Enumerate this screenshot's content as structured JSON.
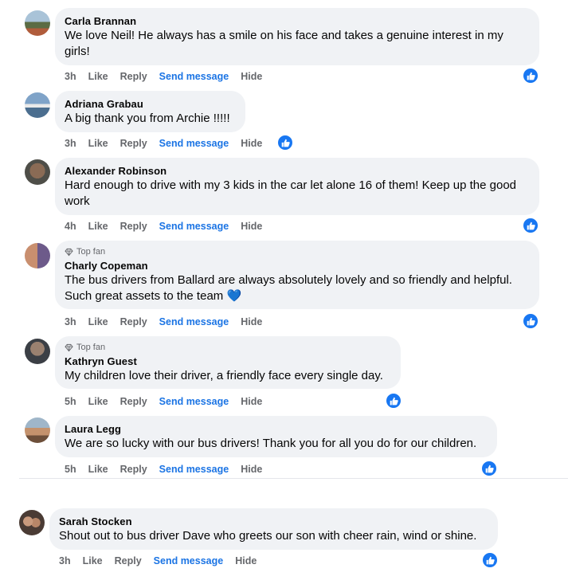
{
  "actions": {
    "like": "Like",
    "reply": "Reply",
    "send": "Send message",
    "hide": "Hide"
  },
  "top_fan_label": "Top fan",
  "colors": {
    "accent": "#1877f2",
    "bubble": "#f0f2f5",
    "muted": "#65676b"
  },
  "comments": [
    {
      "name": "Carla Brannan",
      "text": "We love Neil! He always has a smile on his face and takes a genuine interest in my girls!",
      "time": "3h",
      "top_fan": false
    },
    {
      "name": "Adriana Grabau",
      "text": "A big thank you from Archie !!!!!",
      "time": "3h",
      "top_fan": false
    },
    {
      "name": "Alexander Robinson",
      "text": "Hard enough to drive with my 3 kids in the car let alone 16 of them! Keep up the good work",
      "time": "4h",
      "top_fan": false
    },
    {
      "name": "Charly Copeman",
      "text": "The bus drivers from Ballard are always absolutely lovely and so friendly and helpful. Such great assets to the team 💙",
      "time": "3h",
      "top_fan": true
    },
    {
      "name": "Kathryn Guest",
      "text": "My children love their driver, a friendly face every single day.",
      "time": "5h",
      "top_fan": true
    },
    {
      "name": "Laura Legg",
      "text": "We are so lucky with our bus drivers! Thank you for all you do for our children.",
      "time": "5h",
      "top_fan": false
    },
    {
      "name": "Sarah Stocken",
      "text": "Shout out to bus driver Dave who greets our son with cheer rain, wind or shine.",
      "time": "3h",
      "top_fan": false
    }
  ]
}
